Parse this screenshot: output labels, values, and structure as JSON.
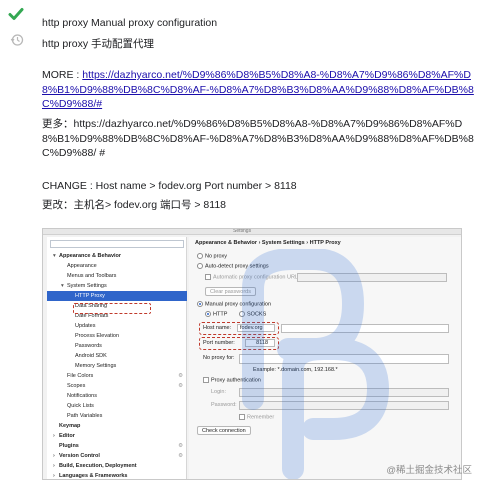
{
  "colors": {
    "accent_check": "#34a853",
    "link": "#1a0dab",
    "selection": "#2f65ca",
    "annotation": "#c0392b"
  },
  "icons": {
    "gutter_top": "check-icon",
    "gutter_second": "history-icon"
  },
  "messages": {
    "title_en": "http proxy Manual proxy configuration",
    "title_zh": "http proxy 手动配置代理",
    "more_label": "MORE : ",
    "more_url": "https://dazhyarco.net/%D9%86%D8%B5%D8%A8-%D8%A7%D9%86%D8%AF%D8%B1%D9%88%DB%8C%D8%AF-%D8%A7%D8%B3%D8%AA%D9%88%D8%AF%DB%8C%D9%88/#",
    "more_zh_label": "更多：",
    "more_zh_text": "https://dazhyarco.net/%D9%86%D8%B5%D8%A8-%D8%A7%D9%86%D8%AF%D8%B1%D9%88%DB%8C%D8%AF-%D8%A7%D8%B3%D8%AA%D9%88%D8%AF%DB%8C%D9%88/ #",
    "change_en": "CHANGE : Host name > fodev.org Port number > 8118",
    "change_zh": "更改：主机名> fodev.org 端口号 > 8118"
  },
  "screenshot": {
    "window_title": "Settings",
    "breadcrumb": "Appearance & Behavior  ›  System Settings  ›  HTTP Proxy",
    "tree": [
      {
        "label": "Appearance & Behavior",
        "level": 0,
        "arrow": "▾",
        "bold": true
      },
      {
        "label": "Appearance",
        "level": 1
      },
      {
        "label": "Menus and Toolbars",
        "level": 1
      },
      {
        "label": "System Settings",
        "level": 1,
        "arrow": "▾"
      },
      {
        "label": "HTTP Proxy",
        "level": 2,
        "selected": true
      },
      {
        "label": "Data Sharing",
        "level": 2
      },
      {
        "label": "Date Formats",
        "level": 2
      },
      {
        "label": "Updates",
        "level": 2
      },
      {
        "label": "Process Elevation",
        "level": 2
      },
      {
        "label": "Passwords",
        "level": 2
      },
      {
        "label": "Android SDK",
        "level": 2
      },
      {
        "label": "Memory Settings",
        "level": 2
      },
      {
        "label": "File Colors",
        "level": 1,
        "cfg": true
      },
      {
        "label": "Scopes",
        "level": 1,
        "cfg": true
      },
      {
        "label": "Notifications",
        "level": 1
      },
      {
        "label": "Quick Lists",
        "level": 1
      },
      {
        "label": "Path Variables",
        "level": 1
      },
      {
        "label": "Keymap",
        "level": 0,
        "bold": true
      },
      {
        "label": "Editor",
        "level": 0,
        "arrow": "›",
        "bold": true
      },
      {
        "label": "Plugins",
        "level": 0,
        "bold": true,
        "cfg": true
      },
      {
        "label": "Version Control",
        "level": 0,
        "arrow": "›",
        "bold": true,
        "cfg": true
      },
      {
        "label": "Build, Execution, Deployment",
        "level": 0,
        "arrow": "›",
        "bold": true
      },
      {
        "label": "Languages & Frameworks",
        "level": 0,
        "arrow": "›",
        "bold": true
      }
    ],
    "no_proxy": "No proxy",
    "auto_detect": "Auto-detect proxy settings",
    "auto_config_url": "Automatic proxy configuration URL:",
    "clear_passwords": "Clear passwords",
    "manual_proxy": "Manual proxy configuration",
    "http": "HTTP",
    "socks": "SOCKS",
    "host_name_label": "Host name:",
    "host_name_value": "fodev.org",
    "port_label": "Port number:",
    "port_value": "8118",
    "no_proxy_for": "No proxy for:",
    "example": "Example: *.domain.com, 192.168.*",
    "proxy_auth": "Proxy authentication",
    "login": "Login:",
    "password": "Password:",
    "remember": "Remember",
    "check_connection": "Check connection",
    "watermark_text": "@稀土掘金技术社区"
  }
}
